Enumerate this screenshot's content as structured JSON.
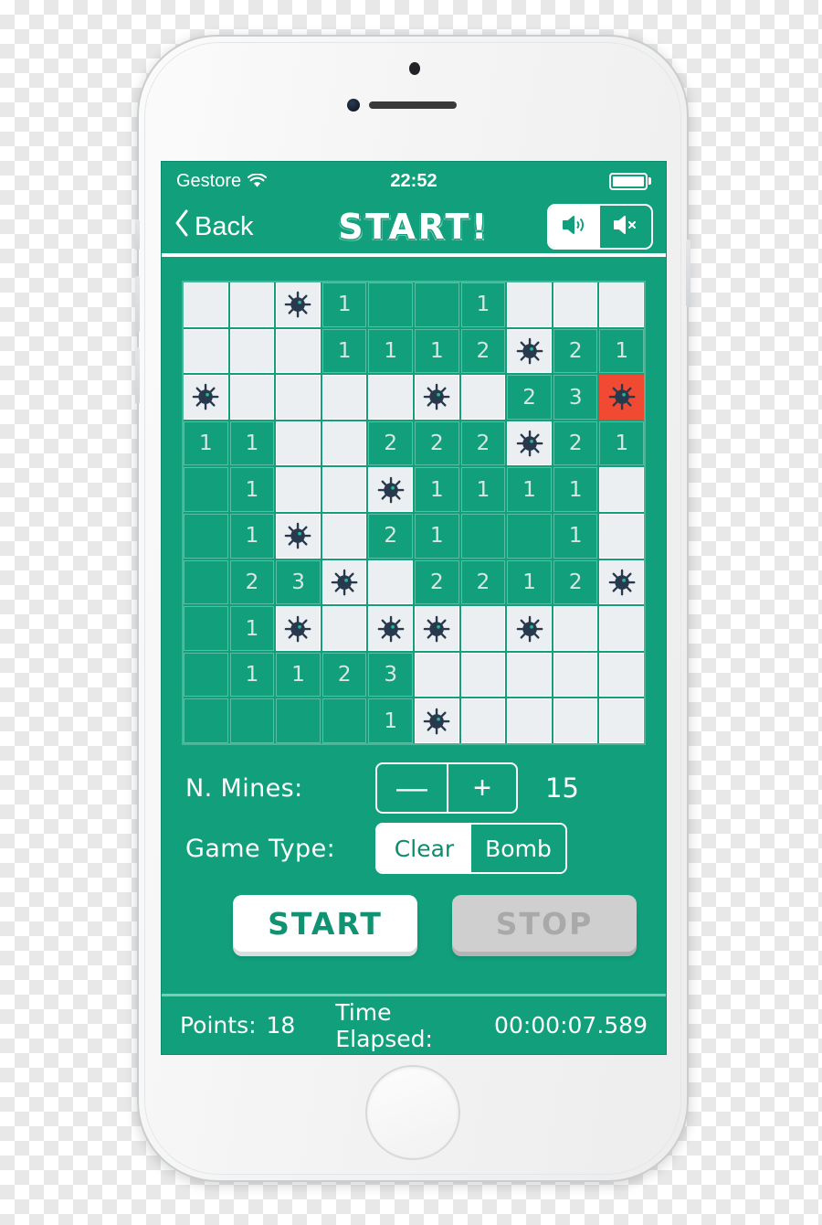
{
  "status_bar": {
    "carrier": "Gestore",
    "wifi_icon": "wifi-icon",
    "clock": "22:52",
    "battery_icon": "battery-full-icon"
  },
  "nav_bar": {
    "back_icon": "chevron-left-icon",
    "back_label": "Back",
    "title": "START!",
    "sound_on_icon": "speaker-on-icon",
    "sound_off_icon": "speaker-muted-icon",
    "sound_selected": "on"
  },
  "controls": {
    "mines_label": "N. Mines:",
    "minus_label": "—",
    "plus_label": "+",
    "mines_value": "15",
    "game_type_label": "Game Type:",
    "game_type_options": [
      "Clear",
      "Bomb"
    ],
    "game_type_selected": "Clear",
    "start_label": "START",
    "stop_label": "STOP"
  },
  "footer": {
    "points_label": "Points:",
    "points_value": "18",
    "time_label": "Time Elapsed:",
    "time_value": "00:00:07.589"
  },
  "colors": {
    "brand_green": "#12a07c",
    "cell_covered": "#eceff1",
    "exploded_red": "#f04a32",
    "number_text": "#d7e7e1",
    "white": "#ffffff"
  },
  "board": {
    "rows": 10,
    "cols": 10,
    "legend": {
      "c": "covered (unrevealed light cell)",
      "m": "mine on light cell",
      "x": "exploded mine on red cell",
      "e": "opened empty cell",
      "digit": "opened cell showing adjacent mine count"
    },
    "cells": [
      [
        "c",
        "c",
        "m",
        "1",
        "e",
        "e",
        "1",
        "c",
        "c",
        "c"
      ],
      [
        "c",
        "c",
        "c",
        "1",
        "1",
        "1",
        "2",
        "m",
        "2",
        "1"
      ],
      [
        "m",
        "c",
        "c",
        "c",
        "c",
        "m",
        "c",
        "2",
        "3",
        "x"
      ],
      [
        "1",
        "1",
        "c",
        "c",
        "2",
        "2",
        "2",
        "m",
        "2",
        "1"
      ],
      [
        "e",
        "1",
        "c",
        "c",
        "m",
        "1",
        "1",
        "1",
        "1",
        "c"
      ],
      [
        "e",
        "1",
        "m",
        "c",
        "2",
        "1",
        "e",
        "e",
        "1",
        "c"
      ],
      [
        "e",
        "2",
        "3",
        "m",
        "c",
        "2",
        "2",
        "1",
        "2",
        "m"
      ],
      [
        "e",
        "1",
        "m",
        "c",
        "m",
        "m",
        "c",
        "m",
        "c",
        "c"
      ],
      [
        "e",
        "1",
        "1",
        "2",
        "3",
        "c",
        "c",
        "c",
        "c",
        "c"
      ],
      [
        "e",
        "e",
        "e",
        "e",
        "1",
        "m",
        "c",
        "c",
        "c",
        "c"
      ]
    ]
  }
}
